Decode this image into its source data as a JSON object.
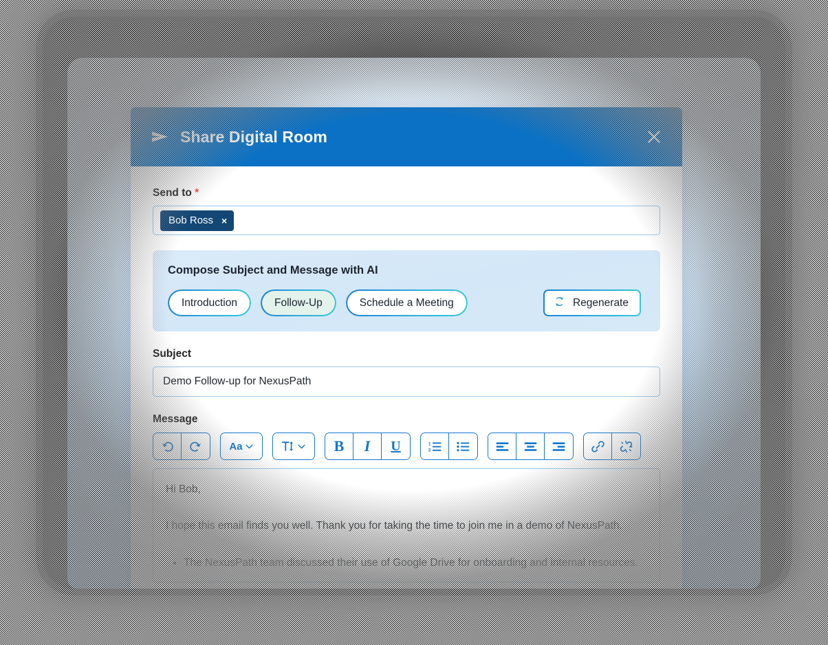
{
  "header": {
    "title": "Share Digital Room",
    "send_icon": "send-plane-icon",
    "close_icon": "close-icon",
    "bg_color": "#0a71c5"
  },
  "send_to": {
    "label": "Send to",
    "required_marker": "*",
    "recipients": [
      {
        "name": "Bob Ross",
        "remove_icon": "×"
      }
    ]
  },
  "ai_compose": {
    "title": "Compose Subject and Message with AI",
    "presets": [
      {
        "label": "Introduction",
        "selected": false
      },
      {
        "label": "Follow-Up",
        "selected": true
      },
      {
        "label": "Schedule a Meeting",
        "selected": false
      }
    ],
    "regenerate": {
      "label": "Regenerate",
      "icon": "refresh-cycle-icon"
    },
    "accent_from": "#1a7fd4",
    "accent_to": "#35c9d6"
  },
  "subject": {
    "label": "Subject",
    "value": "Demo Follow-up for NexusPath",
    "placeholder": "Subject"
  },
  "message": {
    "label": "Message",
    "toolbar_groups": [
      {
        "buttons": [
          {
            "name": "undo-icon",
            "title": "Undo"
          },
          {
            "name": "redo-icon",
            "title": "Redo"
          }
        ]
      },
      {
        "buttons": [
          {
            "name": "font-family-icon",
            "title": "Aa"
          }
        ]
      },
      {
        "buttons": [
          {
            "name": "font-size-icon",
            "title": "T"
          }
        ]
      },
      {
        "buttons": [
          {
            "name": "bold-icon",
            "title": "B"
          },
          {
            "name": "italic-icon",
            "title": "I"
          },
          {
            "name": "underline-icon",
            "title": "U"
          }
        ]
      },
      {
        "buttons": [
          {
            "name": "ordered-list-icon",
            "title": "Numbered list"
          },
          {
            "name": "bullet-list-icon",
            "title": "Bulleted list"
          }
        ]
      },
      {
        "buttons": [
          {
            "name": "align-left-icon",
            "title": "Align left"
          },
          {
            "name": "align-center-icon",
            "title": "Align center"
          },
          {
            "name": "align-right-icon",
            "title": "Align right"
          }
        ]
      },
      {
        "buttons": [
          {
            "name": "link-icon",
            "title": "Insert link"
          },
          {
            "name": "unlink-icon",
            "title": "Remove link"
          }
        ]
      }
    ],
    "body": {
      "greeting": "Hi Bob,",
      "paragraph": "I hope this email finds you well. Thank you for taking the time to join me in a demo of NexusPath.",
      "bullets": [
        "The NexusPath team discussed their use of Google Drive for onboarding and internal resources."
      ]
    }
  },
  "theme": {
    "toolbar_blue": "#1277cd",
    "header_blue": "#0a71c5",
    "token_navy": "#124776",
    "input_border": "#9dc8ea",
    "required_red": "#f0503c",
    "bg_gradient_top": "#e6f2fd",
    "bg_gradient_bottom": "#aed8fb",
    "ai_panel_bg": "#d6e9f8"
  }
}
